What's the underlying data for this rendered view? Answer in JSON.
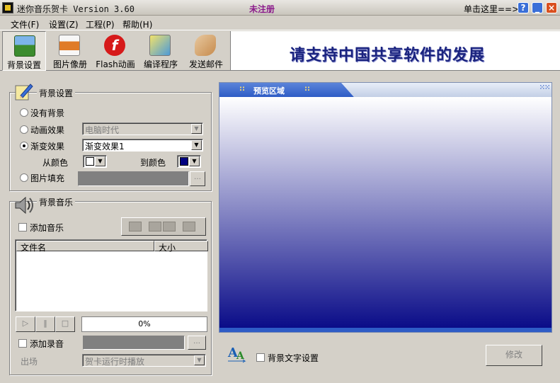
{
  "window": {
    "title": "迷你音乐贺卡 Version 3.60",
    "unregistered": "未注册",
    "click_here": "单击这里==>>",
    "help_glyph": "?",
    "min_glyph": "_",
    "close_glyph": "×"
  },
  "menu": [
    "文件(F)",
    "设置(Z)",
    "工程(P)",
    "帮助(H)"
  ],
  "toolbar": [
    {
      "label": "背景设置",
      "icon": "landscape-icon"
    },
    {
      "label": "图片像册",
      "icon": "photo-album-icon"
    },
    {
      "label": "Flash动画",
      "icon": "flash-icon"
    },
    {
      "label": "编译程序",
      "icon": "compile-icon"
    },
    {
      "label": "发送邮件",
      "icon": "send-mail-icon"
    }
  ],
  "banner": "请支持中国共享软件的发展",
  "background": {
    "title": "背景设置",
    "none": "没有背景",
    "animation": "动画效果",
    "animation_value": "电脑时代",
    "gradient": "渐变效果",
    "gradient_value": "渐变效果1",
    "from_color": "从颜色",
    "to_color": "到颜色",
    "picture": "图片填充",
    "from_color_hex": "#ffffff",
    "to_color_hex": "#000080"
  },
  "music": {
    "title": "背景音乐",
    "add_music": "添加音乐",
    "col_filename": "文件名",
    "col_size": "大小",
    "progress": "0%",
    "add_record": "添加录音",
    "exit_label": "出场",
    "exit_value": "贺卡运行时播放"
  },
  "preview": {
    "title": "预览区域",
    "dots": "::"
  },
  "bottom": {
    "bg_text_setting": "背景文字设置",
    "modify": "修改"
  },
  "colors": {
    "gradient_top": "#ffffff",
    "gradient_bottom": "#0a0c88",
    "preview_header": "#2e5cc6"
  }
}
